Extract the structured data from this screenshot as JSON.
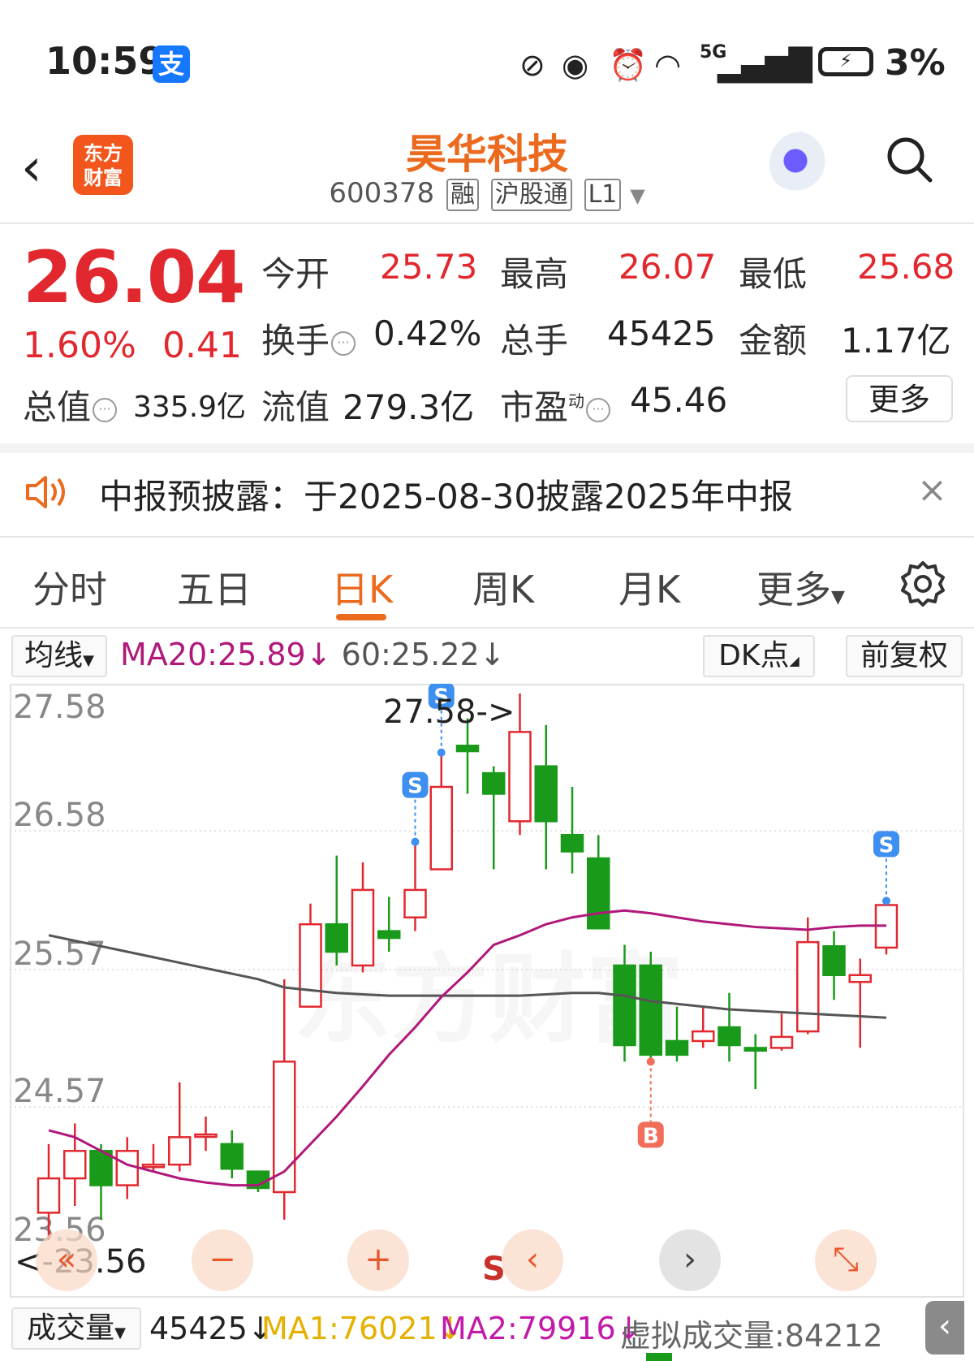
{
  "status": {
    "time": "10:59",
    "alipay_icon": "支",
    "battery": "3%",
    "net": "5G"
  },
  "header": {
    "back_icon": "chevron-left-icon",
    "logo_line1": "东方",
    "logo_line2": "财富",
    "title": "昊华科技",
    "code": "600378",
    "tags": [
      "融",
      "沪股通",
      "L1"
    ]
  },
  "quote": {
    "price": "26.04",
    "change_pct": "1.60%",
    "change_amt": "0.41",
    "open_label": "今开",
    "open": "25.73",
    "high_label": "最高",
    "high": "26.07",
    "low_label": "最低",
    "low": "25.68",
    "turnover_label": "换手",
    "turnover": "0.42%",
    "volume_label": "总手",
    "volume": "45425",
    "amount_label": "金额",
    "amount": "1.17亿",
    "mktcap_label": "总值",
    "mktcap": "335.9亿",
    "float_label": "流值",
    "float_cap": "279.3亿",
    "pe_label": "市盈",
    "pe_super": "动",
    "pe": "45.46",
    "more_label": "更多"
  },
  "notice": {
    "text": "中报预披露：于2025-08-30披露2025年中报",
    "close": "×"
  },
  "tabs": [
    "分时",
    "五日",
    "日K",
    "周K",
    "月K",
    "更多"
  ],
  "active_tab": "日K",
  "chart_header": {
    "ma_select": "均线",
    "ma20": "MA20:25.89↓",
    "ma60": "60:25.22↓",
    "dk_label": "DK点",
    "adjust_label": "前复权"
  },
  "chart_data": {
    "type": "candlestick",
    "y_ticks": [
      "27.58",
      "26.58",
      "25.57",
      "24.57",
      "23.56"
    ],
    "ylim": [
      23.56,
      27.58
    ],
    "max_label": "27.58->",
    "min_label": "<-23.56",
    "candles": [
      {
        "o": 23.8,
        "c": 24.05,
        "h": 24.3,
        "l": 23.6
      },
      {
        "o": 24.05,
        "c": 24.25,
        "h": 24.45,
        "l": 23.85
      },
      {
        "o": 24.25,
        "c": 24.0,
        "h": 24.3,
        "l": 23.75
      },
      {
        "o": 24.0,
        "c": 24.25,
        "h": 24.35,
        "l": 23.9
      },
      {
        "o": 24.15,
        "c": 24.15,
        "h": 24.3,
        "l": 24.1
      },
      {
        "o": 24.15,
        "c": 24.35,
        "h": 24.75,
        "l": 24.1
      },
      {
        "o": 24.37,
        "c": 24.37,
        "h": 24.5,
        "l": 24.25
      },
      {
        "o": 24.3,
        "c": 24.12,
        "h": 24.4,
        "l": 24.05
      },
      {
        "o": 24.1,
        "c": 23.98,
        "h": 24.1,
        "l": 23.95
      },
      {
        "o": 23.95,
        "c": 24.9,
        "h": 25.5,
        "l": 23.75
      },
      {
        "o": 25.3,
        "c": 25.9,
        "h": 26.05,
        "l": 25.3
      },
      {
        "o": 25.9,
        "c": 25.7,
        "h": 26.4,
        "l": 25.6
      },
      {
        "o": 25.6,
        "c": 26.15,
        "h": 26.35,
        "l": 25.55
      },
      {
        "o": 25.85,
        "c": 25.8,
        "h": 26.1,
        "l": 25.7
      },
      {
        "o": 25.95,
        "c": 26.15,
        "h": 26.5,
        "l": 25.85
      },
      {
        "o": 26.3,
        "c": 26.9,
        "h": 27.15,
        "l": 26.3
      },
      {
        "o": 27.2,
        "c": 27.16,
        "h": 27.4,
        "l": 26.85
      },
      {
        "o": 27.0,
        "c": 26.85,
        "h": 27.05,
        "l": 26.3
      },
      {
        "o": 26.65,
        "c": 27.3,
        "h": 27.58,
        "l": 26.55
      },
      {
        "o": 27.05,
        "c": 26.65,
        "h": 27.35,
        "l": 26.3
      },
      {
        "o": 26.55,
        "c": 26.43,
        "h": 26.9,
        "l": 26.27
      },
      {
        "o": 26.38,
        "c": 25.87,
        "h": 26.55,
        "l": 25.87
      },
      {
        "o": 25.6,
        "c": 25.02,
        "h": 25.75,
        "l": 24.9
      },
      {
        "o": 25.6,
        "c": 24.95,
        "h": 25.7,
        "l": 24.9
      },
      {
        "o": 25.05,
        "c": 24.95,
        "h": 25.3,
        "l": 24.9
      },
      {
        "o": 25.05,
        "c": 25.12,
        "h": 25.3,
        "l": 25.0
      },
      {
        "o": 25.15,
        "c": 25.02,
        "h": 25.4,
        "l": 24.9
      },
      {
        "o": 25.0,
        "c": 24.98,
        "h": 25.1,
        "l": 24.7
      },
      {
        "o": 25.0,
        "c": 25.08,
        "h": 25.25,
        "l": 24.98
      },
      {
        "o": 25.12,
        "c": 25.77,
        "h": 25.95,
        "l": 25.1
      },
      {
        "o": 25.74,
        "c": 25.53,
        "h": 25.85,
        "l": 25.35
      },
      {
        "o": 25.48,
        "c": 25.53,
        "h": 25.65,
        "l": 25.0
      },
      {
        "o": 25.73,
        "c": 26.04,
        "h": 26.07,
        "l": 25.68
      }
    ],
    "ma20": [
      24.4,
      24.35,
      24.25,
      24.15,
      24.1,
      24.05,
      24.02,
      24.0,
      24.0,
      24.1,
      24.3,
      24.5,
      24.72,
      24.95,
      25.15,
      25.37,
      25.55,
      25.75,
      25.82,
      25.9,
      25.95,
      25.98,
      26.0,
      25.98,
      25.95,
      25.92,
      25.9,
      25.88,
      25.87,
      25.86,
      25.88,
      25.89,
      25.89
    ],
    "ma60": [
      25.82,
      25.78,
      25.74,
      25.7,
      25.66,
      25.62,
      25.58,
      25.54,
      25.5,
      25.44,
      25.42,
      25.4,
      25.39,
      25.38,
      25.38,
      25.38,
      25.38,
      25.38,
      25.38,
      25.39,
      25.4,
      25.4,
      25.38,
      25.34,
      25.32,
      25.3,
      25.28,
      25.27,
      25.26,
      25.25,
      25.24,
      25.23,
      25.22
    ],
    "signals": [
      {
        "i": 14,
        "type": "S",
        "label": "S"
      },
      {
        "i": 15,
        "type": "S",
        "label": "S"
      },
      {
        "i": 23,
        "type": "B",
        "label": "B"
      },
      {
        "i": 32,
        "type": "S",
        "label": "S"
      }
    ],
    "watermark": "东方财富"
  },
  "controls": {
    "left_fast": "«",
    "zoom_out": "−",
    "zoom_in": "+",
    "prev": "‹",
    "next": "›",
    "expand": "⤡",
    "s_marker": "S"
  },
  "volume_row": {
    "label": "成交量",
    "vol": "45425↓",
    "ma1": "MA1:76021↓",
    "ma2": "MA2:79916↓",
    "virtual": "虚拟成交量:84212",
    "collapse_icon": "‹"
  },
  "colors": {
    "up": "#e2282f",
    "down": "#1a9a1a",
    "accent": "#ec6a1e",
    "ma20": "#b0197a",
    "ma60": "#555555"
  }
}
